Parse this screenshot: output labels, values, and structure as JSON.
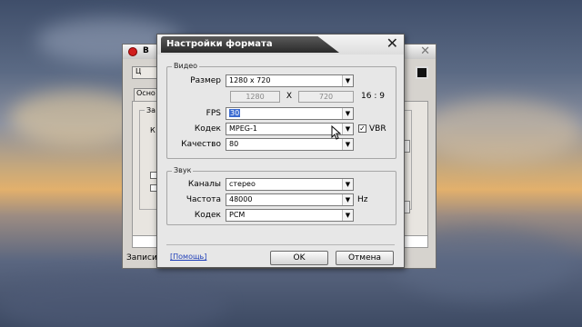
{
  "background_window": {
    "title": "B",
    "button_partial": "Ц",
    "tab_partial": "Осно",
    "group_partial": "За",
    "label_partial": "К",
    "status_partial": "Записи"
  },
  "dialog": {
    "title": "Настройки формата",
    "close_glyph": "✕",
    "video_group": {
      "label": "Видео",
      "size": {
        "label": "Размер",
        "value": "1280 x 720"
      },
      "width_value": "1280",
      "times_glyph": "X",
      "height_value": "720",
      "aspect": "16 : 9",
      "fps": {
        "label": "FPS",
        "value": "30"
      },
      "codec": {
        "label": "Кодек",
        "value": "MPEG-1"
      },
      "vbr": {
        "label": "VBR",
        "checked": true
      },
      "quality": {
        "label": "Качество",
        "value": "80"
      }
    },
    "audio_group": {
      "label": "Звук",
      "channels": {
        "label": "Каналы",
        "value": "стерео"
      },
      "frequency": {
        "label": "Частота",
        "value": "48000",
        "unit": "Hz"
      },
      "codec": {
        "label": "Кодек",
        "value": "PCM"
      }
    },
    "help_link": "[Помощь]",
    "ok_label": "OK",
    "cancel_label": "Отмена"
  },
  "colors": {
    "title_tab": "#2a2a2a",
    "link": "#1f3fb8",
    "selection": "#3b6bd1"
  }
}
